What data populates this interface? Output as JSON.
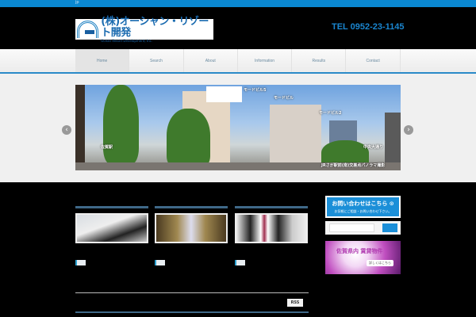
{
  "topbar": {
    "text": "jp"
  },
  "header": {
    "logo_jp": "(株)オーシャン・リゾート開発",
    "logo_en": "Ocean Resort Development, Inc.",
    "tel": "TEL 0952-23-1145"
  },
  "nav": {
    "items": [
      "Home",
      "Search",
      "About",
      "Information",
      "Results",
      "Contact"
    ]
  },
  "slider": {
    "labels": [
      "モードビル5",
      "モードビル",
      "モードビル2",
      "佐賀駅",
      "中央大通り",
      "JRさが駅前(南)交差点パノラマ撮影"
    ],
    "prev": "‹",
    "next": "›"
  },
  "sidebar": {
    "contact_title": "お問い合わせはこちら ⊙",
    "contact_sub": "お気軽にご相談・お問い合わせ下さい。",
    "search_placeholder": "",
    "banner_title": "佐賀県内 賃貸物件",
    "banner_button": "詳しくはこちら"
  },
  "footer": {
    "rss": "RSS"
  }
}
